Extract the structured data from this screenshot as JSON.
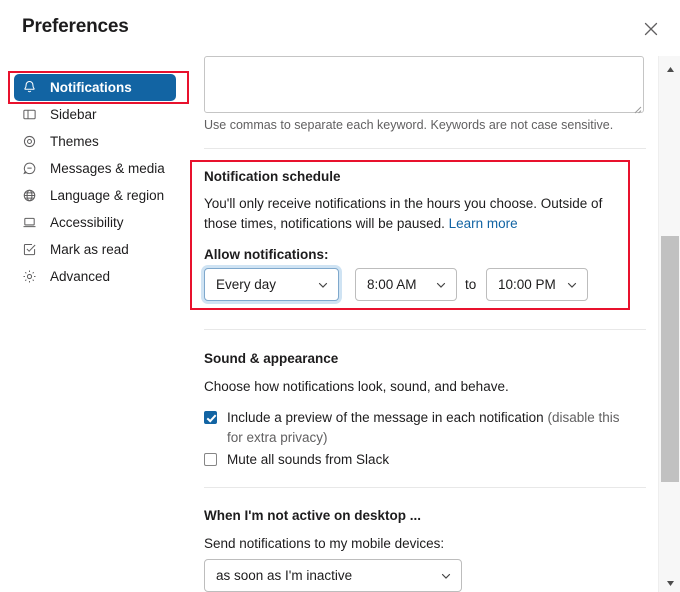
{
  "window": {
    "title": "Preferences",
    "close_label": "×",
    "close_icon": "close-icon"
  },
  "sidebar": {
    "items": [
      {
        "label": "Notifications",
        "icon": "bell-icon",
        "selected": true
      },
      {
        "label": "Sidebar",
        "icon": "sidebar-panel-icon",
        "selected": false
      },
      {
        "label": "Themes",
        "icon": "eye-icon",
        "selected": false
      },
      {
        "label": "Messages & media",
        "icon": "chat-bubble-icon",
        "selected": false
      },
      {
        "label": "Language & region",
        "icon": "globe-icon",
        "selected": false
      },
      {
        "label": "Accessibility",
        "icon": "laptop-icon",
        "selected": false
      },
      {
        "label": "Mark as read",
        "icon": "check-square-icon",
        "selected": false
      },
      {
        "label": "Advanced",
        "icon": "gear-icon",
        "selected": false
      }
    ]
  },
  "main": {
    "keywords": {
      "value": "",
      "placeholder": "",
      "helper": "Use commas to separate each keyword. Keywords are not case sensitive."
    },
    "notification_schedule": {
      "title": "Notification schedule",
      "description_part1": "You'll only receive notifications in the hours you choose. Outside of those times, notifications will be paused. ",
      "learn_more": "Learn more",
      "allow_label": "Allow notifications:",
      "day_select": {
        "value": "Every day",
        "focused": true
      },
      "start_select": {
        "value": "8:00 AM"
      },
      "to_label": "to",
      "end_select": {
        "value": "10:00 PM"
      }
    },
    "sound_appearance": {
      "title": "Sound & appearance",
      "description": "Choose how notifications look, sound, and behave.",
      "checkboxes": [
        {
          "checked": true,
          "text_main": "Include a preview of the message in each notification ",
          "text_muted": "(disable this for extra privacy)"
        },
        {
          "checked": false,
          "text_main": "Mute all sounds from Slack",
          "text_muted": ""
        }
      ]
    },
    "not_active": {
      "title": "When I'm not active on desktop ...",
      "label": "Send notifications to my mobile devices:",
      "mobile_select": {
        "value": "as soon as I'm inactive"
      }
    }
  },
  "scrollbar": {
    "up_icon": "caret-up-icon",
    "down_icon": "caret-down-icon"
  },
  "colors": {
    "accent_blue": "#1264a3",
    "annotation_red": "#e8112d",
    "text_primary": "#1d1c1d",
    "text_muted": "#616061"
  }
}
